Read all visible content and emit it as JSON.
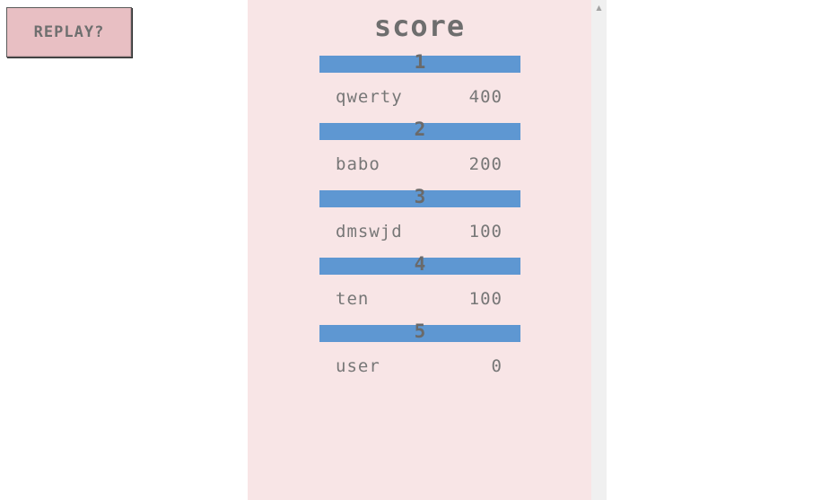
{
  "replay_button": {
    "label": "REPLAY?"
  },
  "scoreboard": {
    "title": "score",
    "entries": [
      {
        "rank": "1",
        "name": "qwerty",
        "score": "400"
      },
      {
        "rank": "2",
        "name": "babo",
        "score": "200"
      },
      {
        "rank": "3",
        "name": "dmswjd",
        "score": "100"
      },
      {
        "rank": "4",
        "name": "ten",
        "score": "100"
      },
      {
        "rank": "5",
        "name": "user",
        "score": "0"
      }
    ]
  },
  "scrollbar": {
    "up_arrow_icon": "triangle-up-icon"
  },
  "colors": {
    "panel_background": "#f8e5e6",
    "rank_bar": "#5e97d2",
    "button_background": "#e8bfc3",
    "text": "#777777"
  }
}
